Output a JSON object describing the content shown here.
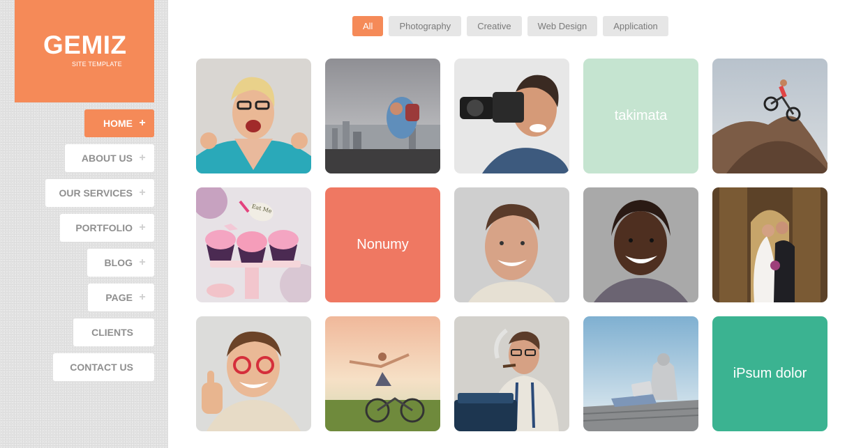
{
  "logo": {
    "title": "GEMIZ",
    "subtitle": "SITE TEMPLATE"
  },
  "nav": [
    {
      "label": "HOME",
      "plus": "+"
    },
    {
      "label": "ABOUT US",
      "plus": "+"
    },
    {
      "label": "OUR SERVICES",
      "plus": "+"
    },
    {
      "label": "PORTFOLIO",
      "plus": "+"
    },
    {
      "label": "BLOG",
      "plus": "+"
    },
    {
      "label": "PAGE",
      "plus": "+"
    },
    {
      "label": "CLIENTS"
    },
    {
      "label": "CONTACT US"
    }
  ],
  "filters": [
    "All",
    "Photography",
    "Creative",
    "Web Design",
    "Application"
  ],
  "tiles": {
    "takimata": "takimata",
    "nonumy": "Nonumy",
    "ipsum": "iPsum dolor",
    "cupcake_sign": "Eat Me"
  },
  "colors": {
    "accent": "#f58a58",
    "mint": "#c5e4d0",
    "coral": "#ef7862",
    "teal": "#3bb391"
  }
}
